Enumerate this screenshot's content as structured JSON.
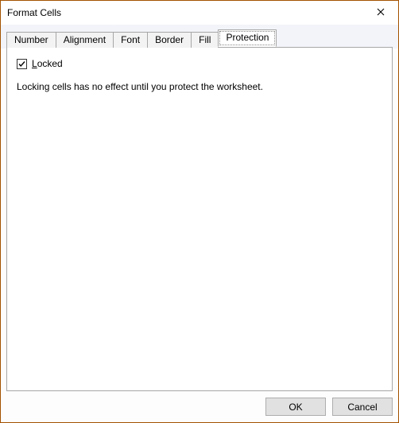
{
  "window": {
    "title": "Format Cells"
  },
  "tabs": [
    {
      "label": "Number"
    },
    {
      "label": "Alignment"
    },
    {
      "label": "Font"
    },
    {
      "label": "Border"
    },
    {
      "label": "Fill"
    },
    {
      "label": "Protection"
    }
  ],
  "active_tab_index": 5,
  "protection": {
    "locked_checked": true,
    "locked_label_pre": "",
    "locked_accel": "L",
    "locked_label_post": "ocked",
    "description": "Locking cells has no effect until you protect the worksheet."
  },
  "buttons": {
    "ok": "OK",
    "cancel": "Cancel"
  }
}
